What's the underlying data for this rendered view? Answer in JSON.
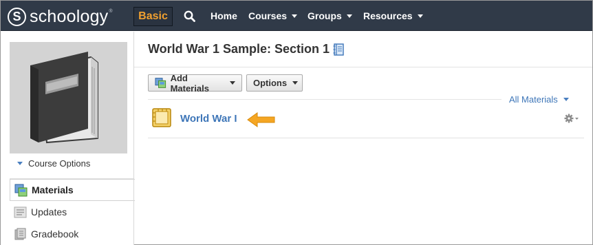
{
  "nav": {
    "logo_badge": "S",
    "logo_text": "schoology",
    "logo_tm": "®",
    "basic_label": "Basic",
    "home_label": "Home",
    "courses_label": "Courses",
    "groups_label": "Groups",
    "resources_label": "Resources",
    "search_icon": "search-icon"
  },
  "sidebar": {
    "course_options_label": "Course Options",
    "items": [
      {
        "label": "Materials",
        "icon": "materials-icon",
        "active": true
      },
      {
        "label": "Updates",
        "icon": "updates-icon",
        "active": false
      },
      {
        "label": "Gradebook",
        "icon": "gradebook-icon",
        "active": false
      }
    ]
  },
  "main": {
    "title": "World War 1 Sample: Section 1",
    "add_materials_label": "Add Materials",
    "options_label": "Options",
    "filter_label": "All Materials",
    "item": {
      "title": "World War I",
      "icon": "folder-icon"
    }
  },
  "colors": {
    "topbar": "#303a48",
    "basic_text": "#f0a030",
    "link": "#3e76b8",
    "arrow": "#f5a623"
  }
}
